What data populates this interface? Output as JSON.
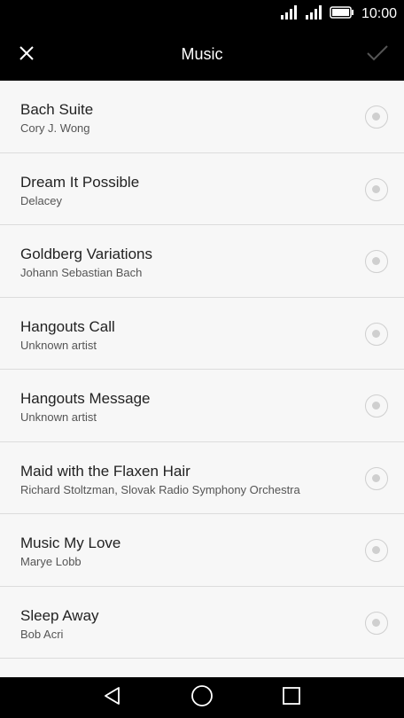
{
  "status_bar": {
    "time": "10:00",
    "icons": [
      "signal-icon",
      "signal-icon",
      "battery-icon"
    ]
  },
  "header": {
    "title": "Music",
    "close_icon": "close-icon",
    "confirm_icon": "check-icon"
  },
  "songs": [
    {
      "title": "Bach Suite",
      "artist": "Cory J. Wong"
    },
    {
      "title": "Dream It Possible",
      "artist": "Delacey"
    },
    {
      "title": "Goldberg Variations",
      "artist": "Johann Sebastian Bach"
    },
    {
      "title": "Hangouts Call",
      "artist": "Unknown artist"
    },
    {
      "title": "Hangouts Message",
      "artist": "Unknown artist"
    },
    {
      "title": "Maid with the Flaxen Hair",
      "artist": "Richard Stoltzman, Slovak Radio Symphony Orchestra"
    },
    {
      "title": "Music My Love",
      "artist": "Marye Lobb"
    },
    {
      "title": "Sleep Away",
      "artist": "Bob Acri"
    }
  ],
  "nav_bar": {
    "icons": [
      "back-icon",
      "home-icon",
      "recents-icon"
    ]
  },
  "colors": {
    "bar_background": "#000000",
    "list_background": "#f7f7f7",
    "radio": "#cfcfcf"
  }
}
